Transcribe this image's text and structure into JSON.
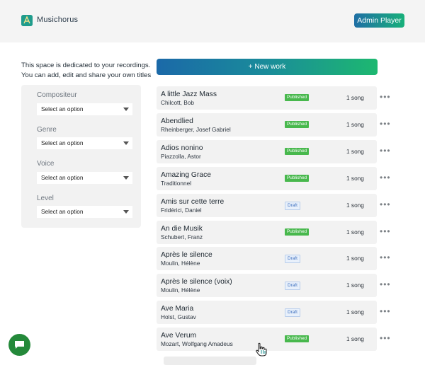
{
  "header": {
    "brand": "Musichorus",
    "admin_button": "Admin Player"
  },
  "intro_text_line1": "This space is dedicated to your recordings.",
  "intro_text_line2": "You can add, edit and share your own titles",
  "new_work_button": "+ New work",
  "filters": [
    {
      "label": "Compositeur",
      "value": "Select an option"
    },
    {
      "label": "Genre",
      "value": "Select an option"
    },
    {
      "label": "Voice",
      "value": "Select an option"
    },
    {
      "label": "Level",
      "value": "Select an option"
    }
  ],
  "works": [
    {
      "title": "A little Jazz Mass",
      "composer": "Chilcott, Bob",
      "status": "Published",
      "songs": "1 song"
    },
    {
      "title": "Abendlied",
      "composer": "Rheinberger, Josef Gabriel",
      "status": "Published",
      "songs": "1 song"
    },
    {
      "title": "Adios nonino",
      "composer": "Piazzolla, Astor",
      "status": "Published",
      "songs": "1 song"
    },
    {
      "title": "Amazing Grace",
      "composer": "Traditionnel",
      "status": "Published",
      "songs": "1 song"
    },
    {
      "title": "Amis sur cette terre",
      "composer": "Fridérici, Daniel",
      "status": "Draft",
      "songs": "1 song"
    },
    {
      "title": "An die Musik",
      "composer": "Schubert, Franz",
      "status": "Published",
      "songs": "1 song"
    },
    {
      "title": "Après le silence",
      "composer": "Moulin, Hélène",
      "status": "Draft",
      "songs": "1 song"
    },
    {
      "title": "Après le silence (voix)",
      "composer": "Moulin, Hélène",
      "status": "Draft",
      "songs": "1 song"
    },
    {
      "title": "Ave Maria",
      "composer": "Holst, Gustav",
      "status": "Draft",
      "songs": "1 song"
    },
    {
      "title": "Ave Verum",
      "composer": "Mozart, Wolfgang Amadeus",
      "status": "Published",
      "songs": "1 song"
    }
  ],
  "more_icon": "more-horizontal-icon",
  "chat_icon": "chat-bubble-icon",
  "colors": {
    "published": "#48b84d",
    "draft": "#3a6dbd",
    "chat_button": "#24893a"
  }
}
